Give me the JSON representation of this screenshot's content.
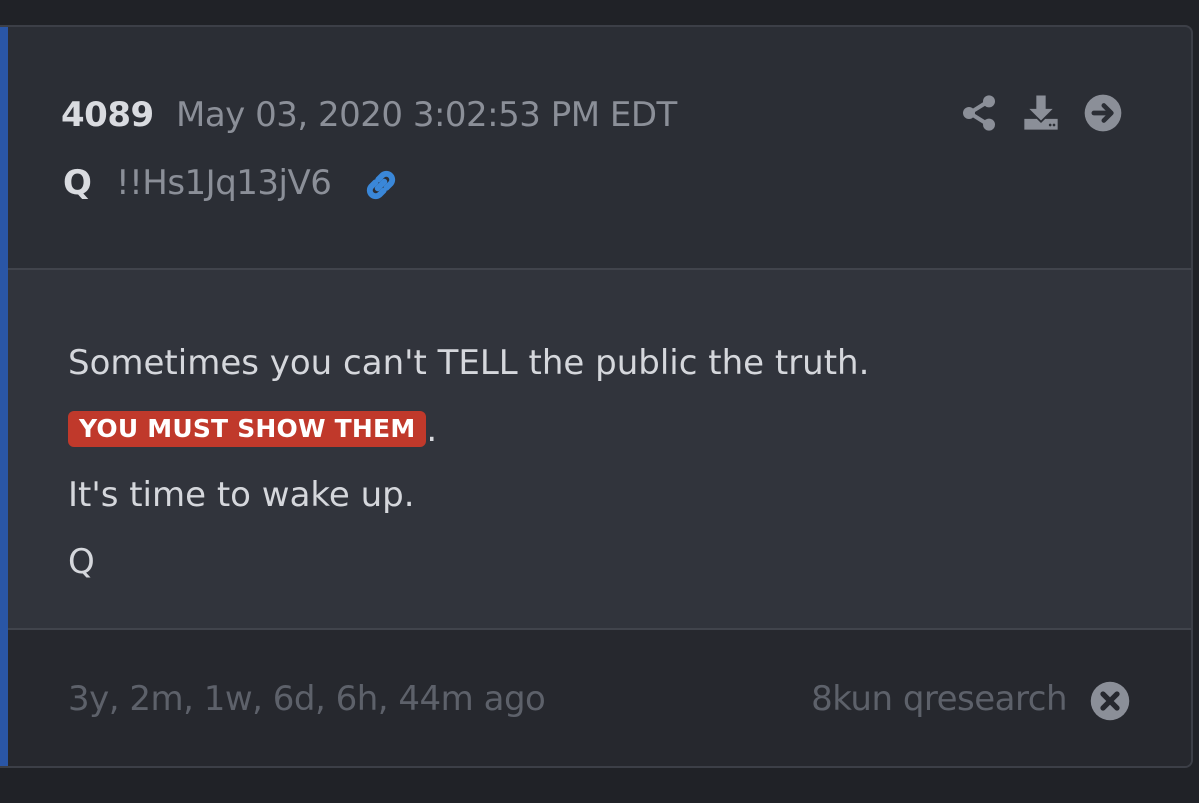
{
  "post": {
    "number": "4089",
    "timestamp": "May 03, 2020 3:02:53 PM EDT",
    "author": "Q",
    "tripcode": "!!Hs1Jq13jV6",
    "lines": {
      "line1": "Sometimes you can't TELL the public the truth.",
      "highlight": "YOU MUST SHOW THEM",
      "highlight_suffix": ".",
      "line3": "It's time to wake up.",
      "line4": "Q"
    }
  },
  "footer": {
    "age": "3y, 2m, 1w, 6d, 6h, 44m ago",
    "source": "8kun qresearch"
  },
  "icons": {
    "link": "link-icon",
    "share": "share-icon",
    "download": "download-icon",
    "next": "arrow-right-circle-icon",
    "close": "close-circle-icon"
  },
  "colors": {
    "background": "#202227",
    "card": "#2b2e35",
    "body": "#31343c",
    "accent": "#2a56a6",
    "highlight": "#c0392b",
    "link": "#3a87d8",
    "muted_text": "#8b8f98"
  }
}
